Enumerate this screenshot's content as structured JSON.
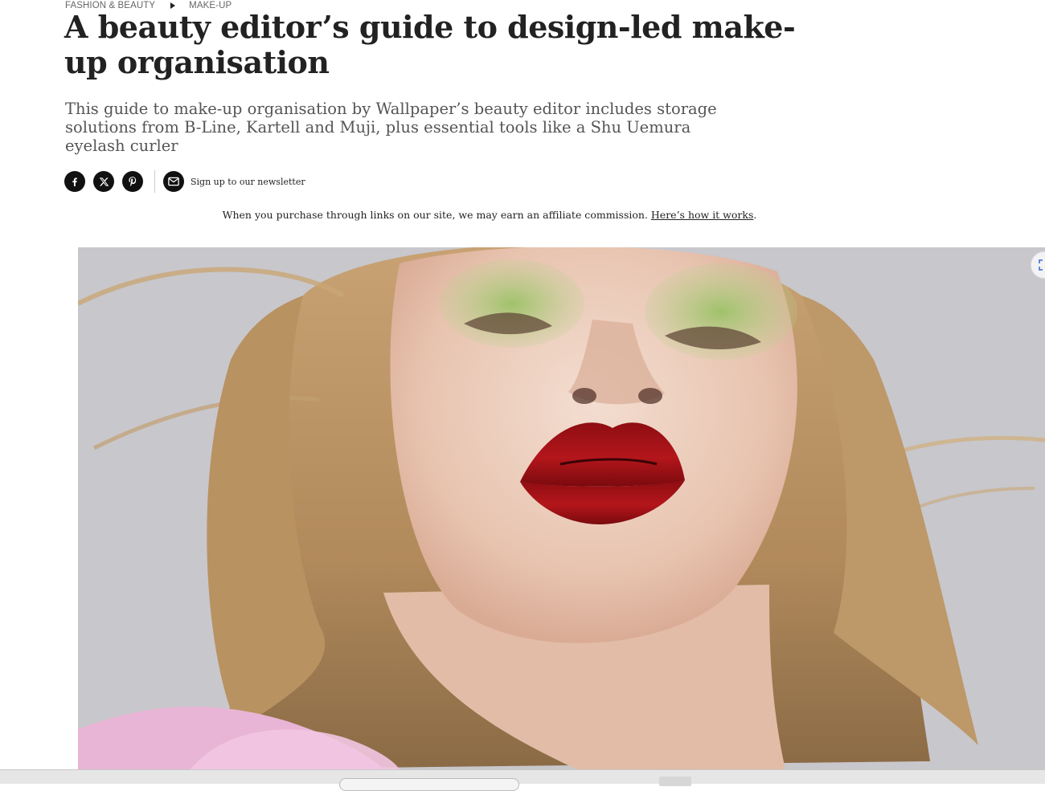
{
  "breadcrumb": {
    "section": "FASHION & BEAUTY",
    "subsection": "MAKE-UP"
  },
  "article": {
    "title": "A beauty editor’s guide to design-led make-up organisation",
    "standfirst": "This guide to make-up organisation by Wallpaper’s beauty editor includes storage solutions from B-Line, Kartell and Muji, plus essential tools like a Shu Uemura eyelash curler"
  },
  "share": {
    "icons": [
      "facebook-icon",
      "x-icon",
      "pinterest-icon",
      "mail-icon"
    ],
    "newsletter_label": "Sign up to our newsletter"
  },
  "affiliate": {
    "text": "When you purchase through links on our site, we may earn an affiliate commission.",
    "link_label": "Here’s how it works",
    "trailing": "."
  },
  "colors": {
    "text": "#222222",
    "muted": "#666666",
    "standfirst": "#555555",
    "icon_bg": "#111111",
    "hero_bg": "#c9c8cc"
  }
}
